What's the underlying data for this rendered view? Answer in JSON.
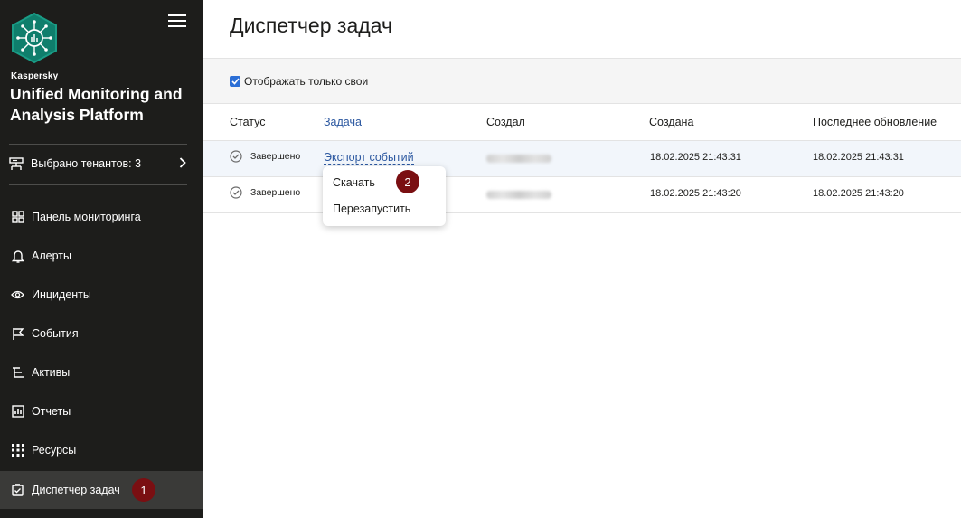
{
  "sidebar": {
    "brand_small": "Kaspersky",
    "brand_title": "Unified Monitoring and Analysis Platform",
    "tenant_label": "Выбрано тенантов: 3",
    "items": [
      {
        "label": "Панель мониторинга",
        "icon": "dashboard-icon"
      },
      {
        "label": "Алерты",
        "icon": "bell-icon"
      },
      {
        "label": "Инциденты",
        "icon": "eye-icon"
      },
      {
        "label": "События",
        "icon": "flag-icon"
      },
      {
        "label": "Активы",
        "icon": "tree-icon"
      },
      {
        "label": "Отчеты",
        "icon": "report-icon"
      },
      {
        "label": "Ресурсы",
        "icon": "grid-icon"
      },
      {
        "label": "Диспетчер задач",
        "icon": "task-icon",
        "active": true
      }
    ],
    "callout": "1"
  },
  "main": {
    "title": "Диспетчер задач",
    "filter_label": "Отображать только свои",
    "columns": [
      "Статус",
      "Задача",
      "Создал",
      "Создана",
      "Последнее обновление"
    ],
    "rows": [
      {
        "status": "Завершено",
        "task": "Экспорт событий",
        "created": "18.02.2025 21:43:31",
        "updated": "18.02.2025 21:43:31"
      },
      {
        "status": "Завершено",
        "task": "",
        "created": "18.02.2025 21:43:20",
        "updated": "18.02.2025 21:43:20"
      }
    ],
    "menu": {
      "download": "Скачать",
      "restart": "Перезапустить"
    },
    "callout": "2"
  },
  "colors": {
    "sidebar_bg": "#1d1d1b",
    "accent": "#2c6fd6",
    "link": "#2c58a0",
    "callout": "#7a0f12"
  }
}
